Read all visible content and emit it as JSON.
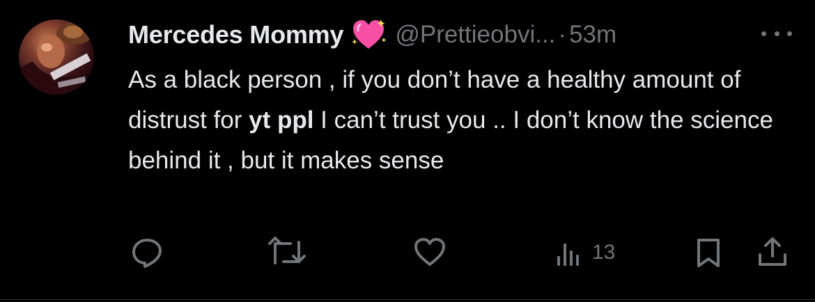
{
  "tweet": {
    "display_name": "Mercedes Mommy",
    "name_emoji": "💖",
    "handle": "@Prettieobvi...",
    "separator": "·",
    "time": "53m",
    "text_before": "As a black person , if you don’t have a healthy amount of distrust for ",
    "text_bold": "yt ppl",
    "text_after": " I can’t trust you .. I don’t know the science behind it , but it makes sense"
  },
  "actions": {
    "reply_icon": "reply-icon",
    "retweet_icon": "retweet-icon",
    "like_icon": "heart-icon",
    "views_icon": "views-icon",
    "views_count": "13",
    "bookmark_icon": "bookmark-icon",
    "share_icon": "share-icon"
  },
  "colors": {
    "background": "#000000",
    "primary_text": "#e7e9ea",
    "secondary_text": "#71767b",
    "emoji_pink": "#f74fa6"
  }
}
